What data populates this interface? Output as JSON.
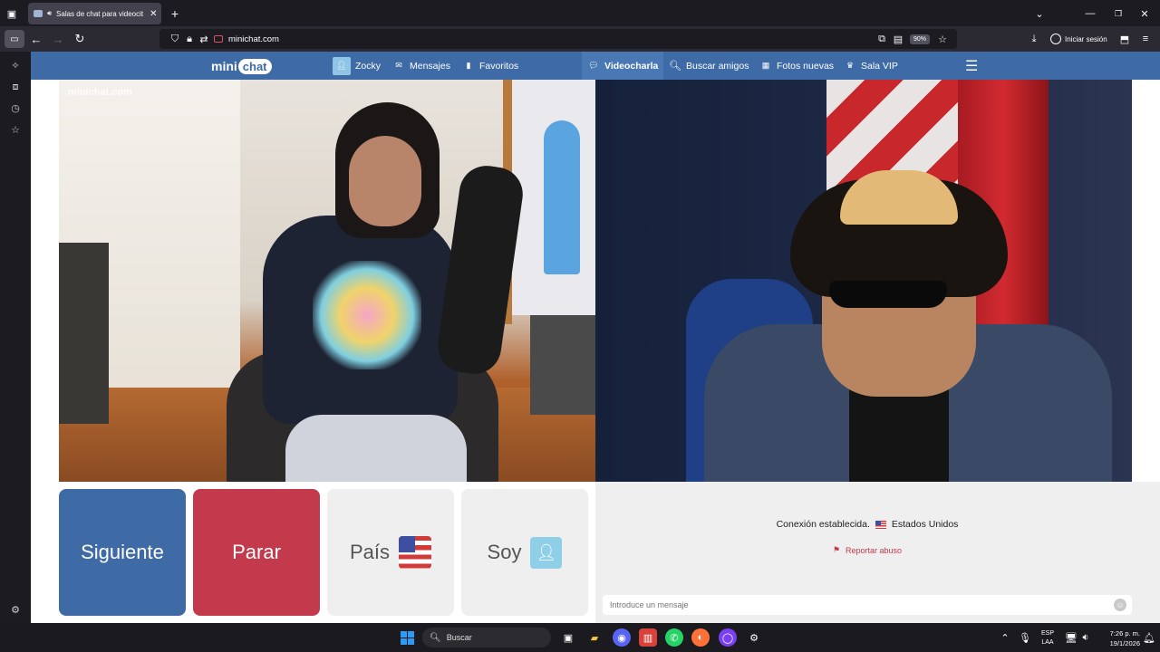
{
  "browser": {
    "tab_title": "Salas de chat para videocit",
    "tab_audio_icon": "speaker-icon",
    "new_tab": "+",
    "url": "minichat.com",
    "zoom": "90%",
    "signin_label": "Iniciar sesión"
  },
  "site": {
    "logo_mini": "mini",
    "logo_chat": "chat",
    "nav": {
      "zocky": "Zocky",
      "mensajes": "Mensajes",
      "favoritos": "Favoritos",
      "videocharla": "Videocharla",
      "buscar_amigos": "Buscar amigos",
      "fotos_nuevas": "Fotos nuevas",
      "sala_vip": "Sala VIP"
    },
    "watermark": "minichat.com"
  },
  "controls": {
    "siguiente": "Siguiente",
    "parar": "Parar",
    "pais": "País",
    "soy": "Soy"
  },
  "status": {
    "connection": "Conexión establecida.",
    "country": "Estados Unidos",
    "report": "Reportar abuso",
    "input_placeholder": "Introduce un mensaje"
  },
  "taskbar": {
    "search": "Buscar",
    "lang_top": "ESP",
    "lang_bottom": "LAA",
    "time": "7:26 p. m.",
    "date": "19/1/2026"
  },
  "colors": {
    "site_blue": "#3e6aa6",
    "siguiente": "#3e6aa6",
    "parar": "#c23a4b",
    "neutral_btn": "#efefef"
  }
}
